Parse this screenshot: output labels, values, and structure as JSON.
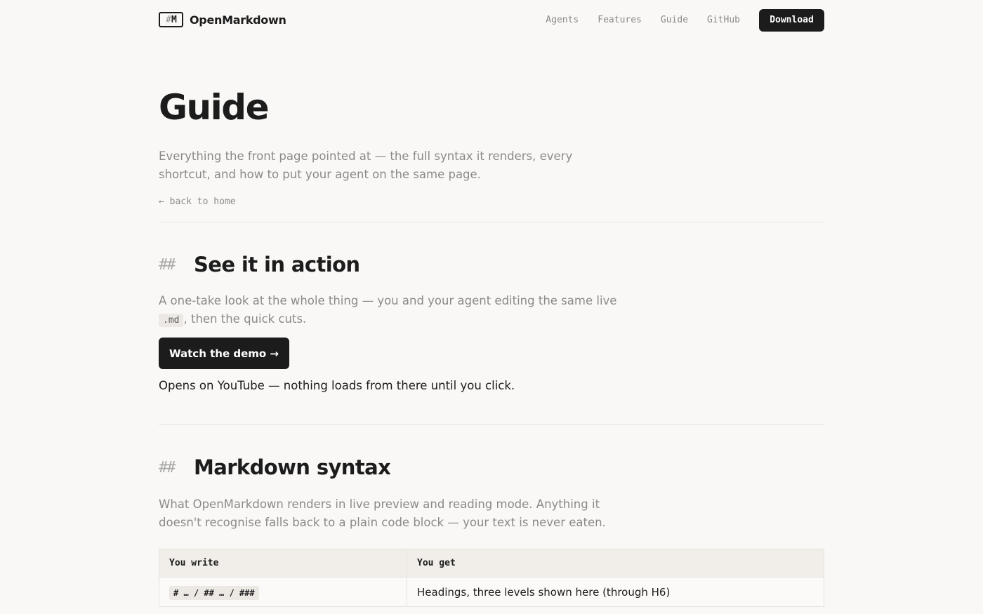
{
  "header": {
    "logo_mark_hash": "#",
    "logo_mark_letter": "M",
    "logo_text": "OpenMarkdown",
    "nav": [
      "Agents",
      "Features",
      "Guide",
      "GitHub"
    ],
    "download_label": "Download"
  },
  "hero": {
    "title": "Guide",
    "intro": "Everything the front page pointed at — the full syntax it renders, every shortcut, and how to put your agent on the same page.",
    "back_link": "← back to home"
  },
  "section_demo": {
    "hash": "##",
    "title": "See it in action",
    "para_before": "A one-take look at the whole thing — you and your agent editing the same live ",
    "code": ".md",
    "para_after": ", then the quick cuts.",
    "button_label": "Watch the demo →",
    "note": "Opens on YouTube — nothing loads from there until you click."
  },
  "section_syntax": {
    "hash": "##",
    "title": "Markdown syntax",
    "para": "What OpenMarkdown renders in live preview and reading mode. Anything it doesn't recognise falls back to a plain code block — your text is never eaten.",
    "table": {
      "headers": [
        "You write",
        "You get"
      ],
      "rows": [
        {
          "write": "# … / ## … / ###",
          "get": "Headings, three levels shown here (through H6)"
        }
      ]
    }
  }
}
